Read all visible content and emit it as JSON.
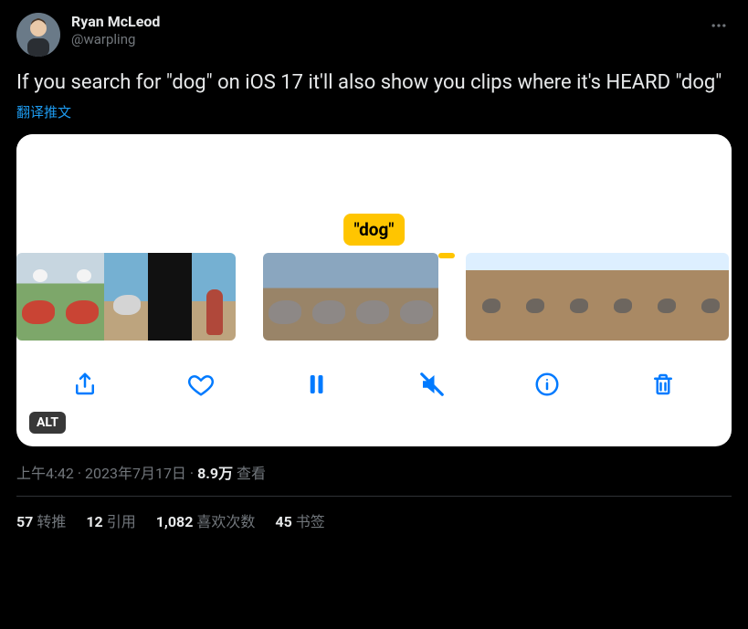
{
  "user": {
    "display_name": "Ryan McLeod",
    "handle": "@warpling"
  },
  "tweet_text": "If you search for \"dog\" on iOS 17 it'll also show you clips where it's HEARD \"dog\"",
  "translate_label": "翻译推文",
  "media": {
    "search_term": "\"dog\"",
    "alt_badge": "ALT",
    "controls": {
      "share": "share",
      "like": "like",
      "pause": "pause",
      "mute": "mute",
      "info": "info",
      "delete": "delete"
    }
  },
  "meta": {
    "time": "上午4:42",
    "separator": " · ",
    "date": "2023年7月17日",
    "views_count": "8.9万",
    "views_label": " 查看"
  },
  "stats": {
    "retweets_count": "57",
    "retweets_label": "转推",
    "quotes_count": "12",
    "quotes_label": "引用",
    "likes_count": "1,082",
    "likes_label": "喜欢次数",
    "bookmarks_count": "45",
    "bookmarks_label": "书签"
  }
}
